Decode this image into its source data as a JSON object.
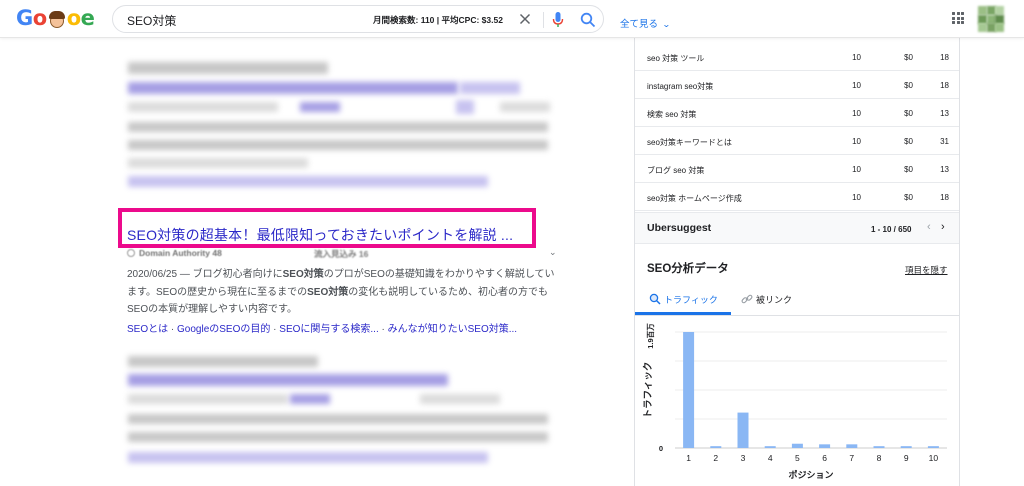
{
  "header": {
    "logo_letters": [
      {
        "char": "G",
        "color": "#4285f4"
      },
      {
        "char": "o",
        "color": "#ea4335"
      },
      {
        "char": "o",
        "color": "#fbbc05"
      },
      {
        "char": "e",
        "color": "#34a853"
      }
    ],
    "search_query": "SEO対策",
    "search_meta": "月間検索数: 110 | 平均CPC: $3.52",
    "all_link": "全て見る",
    "icons": [
      "clear-icon",
      "mic-icon",
      "search-icon",
      "apps-grid-icon",
      "avatar"
    ]
  },
  "result": {
    "title": "SEO対策の超基本！最低限知っておきたいポイントを解説 ...",
    "sub_info": "Domain Authority 48",
    "sub_info2": "流入見込み 16",
    "snippet_parts": [
      {
        "text": "2020/06/25 — ブログ初心者向けに",
        "bold": false
      },
      {
        "text": "SEO対策",
        "bold": true
      },
      {
        "text": "のプロがSEOの基礎知識をわかりやすく解説しています。SEOの歴史から現在に至るまでの",
        "bold": false
      },
      {
        "text": "SEO対策",
        "bold": true
      },
      {
        "text": "の変化も説明しているため、初心者の方でもSEOの本質が理解しやすい内容です。",
        "bold": false
      }
    ],
    "sitelinks": [
      "SEOとは",
      "GoogleのSEOの目的",
      "SEOに関与する検索...",
      "みんなが知りたいSEO対策..."
    ]
  },
  "keywords": [
    {
      "keyword": "seo 対策 ツール",
      "volume": "10",
      "cpc": "$0",
      "sd": "18"
    },
    {
      "keyword": "instagram seo対策",
      "volume": "10",
      "cpc": "$0",
      "sd": "18"
    },
    {
      "keyword": "検索 seo 対策",
      "volume": "10",
      "cpc": "$0",
      "sd": "13"
    },
    {
      "keyword": "seo対策キーワードとは",
      "volume": "10",
      "cpc": "$0",
      "sd": "31"
    },
    {
      "keyword": "ブログ seo 対策",
      "volume": "10",
      "cpc": "$0",
      "sd": "13"
    },
    {
      "keyword": "seo対策 ホームページ作成",
      "volume": "10",
      "cpc": "$0",
      "sd": "18"
    }
  ],
  "ubersuggest": {
    "title": "Ubersuggest",
    "range": "1 - 10 / 650"
  },
  "seo_panel": {
    "title": "SEO分析データ",
    "hide_label": "項目を隠す",
    "tab_traffic": "トラフィック",
    "tab_links": "被リンク"
  },
  "colors": {
    "highlight": "#ec0a8c",
    "link": "#2b28c8",
    "bar": "#8ab7f4",
    "accent": "#1a73e8"
  },
  "chart_data": {
    "type": "bar",
    "categories": [
      "1",
      "2",
      "3",
      "4",
      "5",
      "6",
      "7",
      "8",
      "9",
      "10"
    ],
    "values": [
      1.9,
      0.03,
      0.58,
      0.03,
      0.07,
      0.06,
      0.06,
      0.03,
      0.03,
      0.03
    ],
    "ylabel": "トラフィック",
    "xlabel": "ポジション",
    "ytick_top": "1.9百万",
    "ytick_zero": "0",
    "ylim": [
      0,
      1.9
    ]
  }
}
